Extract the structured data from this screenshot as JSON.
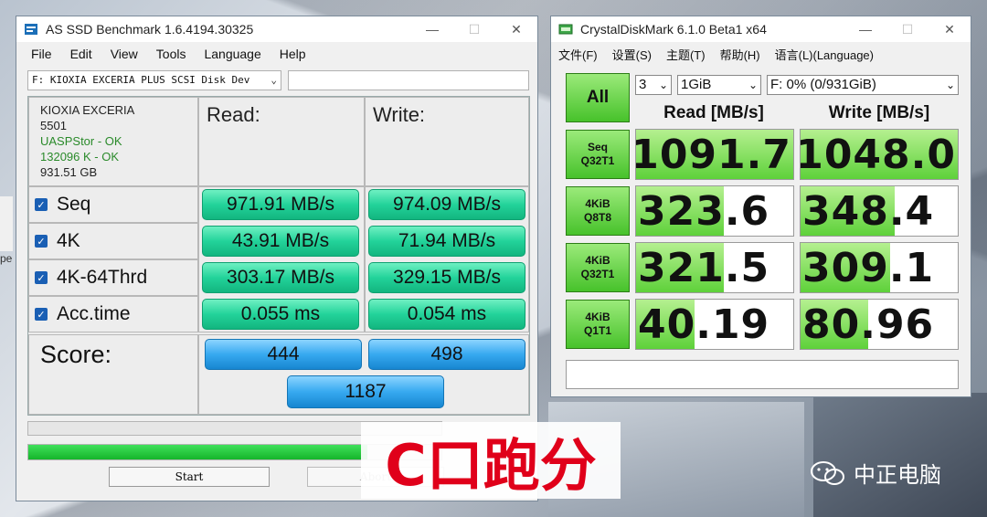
{
  "asssd": {
    "title": "AS SSD Benchmark 1.6.4194.30325",
    "menu": [
      "File",
      "Edit",
      "View",
      "Tools",
      "Language",
      "Help"
    ],
    "drive_select": "F: KIOXIA EXCERIA PLUS SCSI Disk Dev",
    "info": {
      "model": "KIOXIA EXCERIA",
      "fw": "5501",
      "driver": "UASPStor - OK",
      "align": "132096 K - OK",
      "size": "931.51 GB"
    },
    "headers": {
      "read": "Read:",
      "write": "Write:"
    },
    "rows": [
      {
        "label": "Seq",
        "read": "971.91 MB/s",
        "write": "974.09 MB/s"
      },
      {
        "label": "4K",
        "read": "43.91 MB/s",
        "write": "71.94 MB/s"
      },
      {
        "label": "4K-64Thrd",
        "read": "303.17 MB/s",
        "write": "329.15 MB/s"
      },
      {
        "label": "Acc.time",
        "read": "0.055 ms",
        "write": "0.054 ms"
      }
    ],
    "score": {
      "label": "Score:",
      "read": "444",
      "write": "498",
      "total": "1187"
    },
    "progress_fraction": 0.82,
    "start_label": "Start",
    "abort_label": "Abort"
  },
  "cdm": {
    "title": "CrystalDiskMark 6.1.0 Beta1 x64",
    "menu": [
      "文件(F)",
      "设置(S)",
      "主题(T)",
      "帮助(H)",
      "语言(L)(Language)"
    ],
    "all_label": "All",
    "count": "3",
    "size": "1GiB",
    "drive": "F: 0% (0/931GiB)",
    "read_header": "Read [MB/s]",
    "write_header": "Write [MB/s]",
    "tests": [
      {
        "l1": "Seq",
        "l2": "Q32T1",
        "read": "1091.7",
        "write": "1048.0",
        "rf": 1.0,
        "wf": 1.0
      },
      {
        "l1": "4KiB",
        "l2": "Q8T8",
        "read": "323.6",
        "write": "348.4",
        "rf": 0.56,
        "wf": 0.6
      },
      {
        "l1": "4KiB",
        "l2": "Q32T1",
        "read": "321.5",
        "write": "309.1",
        "rf": 0.56,
        "wf": 0.57
      },
      {
        "l1": "4KiB",
        "l2": "Q1T1",
        "read": "40.19",
        "write": "80.96",
        "rf": 0.37,
        "wf": 0.43
      }
    ]
  },
  "overlay_text": "C口跑分",
  "watermark": "中正电脑",
  "desktop_fragment_text": "pe"
}
